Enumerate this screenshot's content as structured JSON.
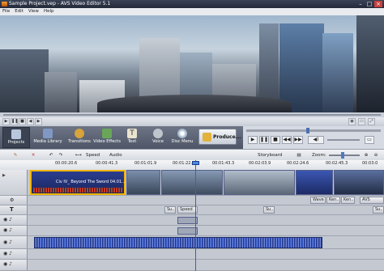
{
  "window": {
    "title": "Sample Project.vep - AVS Video Editor 5.1"
  },
  "menu": [
    {
      "label": "File"
    },
    {
      "label": "Edit"
    },
    {
      "label": "View"
    },
    {
      "label": "Help"
    }
  ],
  "toolbar": {
    "tools": [
      {
        "label": "Projects",
        "icon": "projects-icon"
      },
      {
        "label": "Media Library",
        "icon": "media-library-icon"
      },
      {
        "label": "Transitions",
        "icon": "transitions-icon"
      },
      {
        "label": "Video Effects",
        "icon": "video-effects-icon"
      },
      {
        "label": "Text",
        "icon": "text-icon"
      },
      {
        "label": "Voice",
        "icon": "voice-icon"
      },
      {
        "label": "Disc Menu",
        "icon": "disc-menu-icon"
      }
    ],
    "produce_label": "Produce..."
  },
  "editbar": {
    "speed_label": "Speed",
    "audio_label": "Audio",
    "storyboard_label": "Storyboard",
    "zoom_label": "Zoom:"
  },
  "ruler": {
    "ticks": [
      "00:00:20.6",
      "00:00:41.3",
      "00:01:01.9",
      "00:01:22.6",
      "00:01:43.3",
      "00:02:03.9",
      "00:02:24.6",
      "00:02:45.3",
      "00:03:0"
    ]
  },
  "timeline": {
    "selected_clip_label": "Civ IV_ Beyond The Sword 04.01...",
    "effect_chips": [
      "Wave",
      "Ken...",
      "Ken...",
      "AVS Vide..."
    ],
    "text_chips": [
      "Su...",
      "Speed & ...",
      "Su...",
      "Su..."
    ]
  },
  "colors": {
    "accent": "#2e64c7",
    "selected_clip": "#f0b400",
    "audio_wave": "#3a5cc7"
  }
}
